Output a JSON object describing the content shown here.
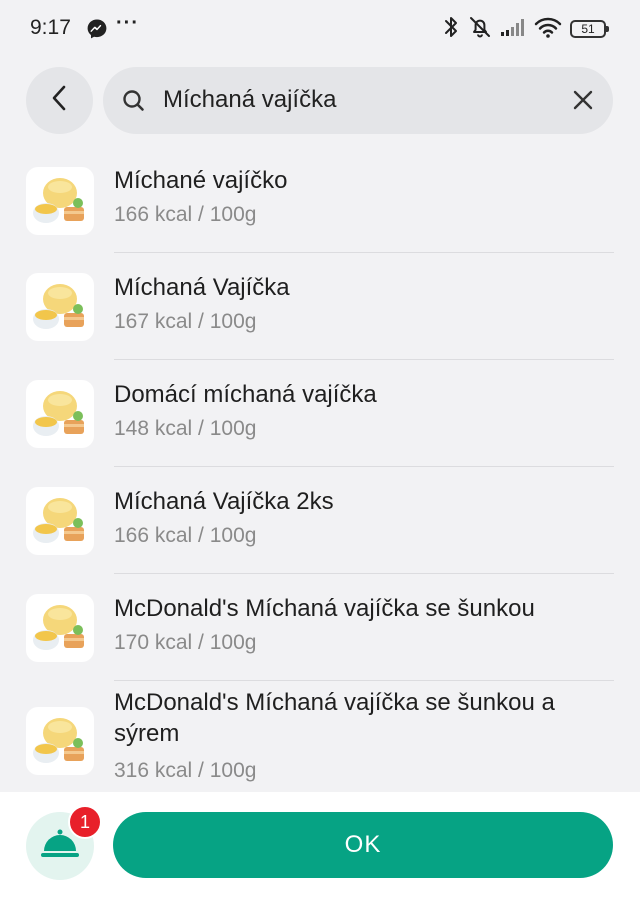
{
  "status_bar": {
    "time": "9:17",
    "more": "···",
    "battery": "51",
    "icons": [
      "messenger-icon",
      "bluetooth-icon",
      "bell-muted-icon",
      "signal-icon",
      "wifi-icon",
      "battery-icon"
    ]
  },
  "search": {
    "query": "Míchaná vajíčka",
    "back_icon": "chevron-left-icon",
    "search_icon": "search-icon",
    "clear_icon": "close-icon"
  },
  "results": [
    {
      "title": "Míchané vajíčko",
      "kcal": "166 kcal / 100g"
    },
    {
      "title": "Míchaná Vajíčka",
      "kcal": "167 kcal / 100g"
    },
    {
      "title": "Domácí míchaná vajíčka",
      "kcal": "148 kcal / 100g"
    },
    {
      "title": "Míchaná Vajíčka 2ks",
      "kcal": "166 kcal / 100g"
    },
    {
      "title": "McDonald's Míchaná vajíčka se šunkou",
      "kcal": "170 kcal / 100g"
    },
    {
      "title": "McDonald's Míchaná vajíčka se šunkou a sýrem",
      "kcal": "316 kcal / 100g"
    }
  ],
  "bottom": {
    "badge_count": "1",
    "ok_label": "OK",
    "accent": "#06a384",
    "badge_color": "#e8202a"
  }
}
